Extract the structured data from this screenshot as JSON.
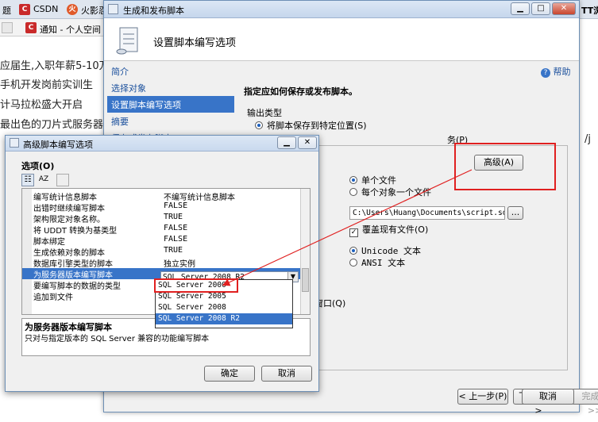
{
  "browser": {
    "tabs": [
      {
        "label": "CSDN",
        "fav": "C",
        "color": "#c92a2a"
      },
      {
        "label": "火影忍",
        "fav": "火",
        "color": "#e05a2a"
      }
    ],
    "second_tab": {
      "label": "通知 - 个人空间 -",
      "fav": "C"
    },
    "bg_lines": [
      "应届生,入职年薪5-10万",
      "手机开发岗前实训生",
      "计马拉松盛大开启",
      "最出色的刀片式服务器"
    ],
    "right_text": "/j"
  },
  "wizard": {
    "title": "生成和发布脚本",
    "header_title": "设置脚本编写选项",
    "help_label": "帮助",
    "nav_items": [
      "简介",
      "选择对象",
      "设置脚本编写选项",
      "摘要",
      "保存或发布脚本"
    ],
    "instruction": "指定应如何保存或发布脚本。",
    "output_type_label": "输出类型",
    "radio_save_to_location": "将脚本保存到特定位置(S)",
    "radio_publish_partial": "务(P)",
    "advanced_button": "高级(A)",
    "single_file": "单个文件",
    "file_per_object": "每个对象一个文件",
    "file_path": "C:\\Users\\Huang\\Documents\\script.sql",
    "browse_button": "...",
    "overwrite_label": "覆盖现有文件(O)",
    "unicode_text": "Unicode 文本",
    "ansi_text": "ANSI 文本",
    "query_window_fragment": "窗口(Q)",
    "buttons": {
      "prev": "< 上一步(P)",
      "next": "下一步(N) >",
      "finish": "完成(F) >>|",
      "cancel": "取消"
    }
  },
  "advanced_dialog": {
    "title": "高级脚本编写选项",
    "options_label": "选项(O)",
    "properties": [
      {
        "name": "编写统计信息脚本",
        "value": "不编写统计信息脚本"
      },
      {
        "name": "出错时继续编写脚本",
        "value": "FALSE"
      },
      {
        "name": "架构限定对象名称。",
        "value": "TRUE"
      },
      {
        "name": "将 UDDT 转换为基类型",
        "value": "FALSE"
      },
      {
        "name": "脚本绑定",
        "value": "FALSE"
      },
      {
        "name": "生成依赖对象的脚本",
        "value": "TRUE"
      },
      {
        "name": "数据库引擎类型的脚本",
        "value": "独立实例"
      },
      {
        "name": "为服务器版本编写脚本",
        "value": "SQL Server 2008 R2"
      },
      {
        "name": "要编写脚本的数据的类型",
        "value": ""
      },
      {
        "name": "追加到文件",
        "value": ""
      }
    ],
    "dropdown_options": [
      "SQL Server 2000",
      "SQL Server 2005",
      "SQL Server 2008",
      "SQL Server 2008 R2"
    ],
    "description_title": "为服务器版本编写脚本",
    "description_text": "只对与指定版本的 SQL Server 兼容的功能编写脚本",
    "ok_button": "确定",
    "cancel_button": "取消"
  },
  "colors": {
    "selection": "#3874c8",
    "annotation": "#e02020",
    "link": "#1a4f9c"
  }
}
